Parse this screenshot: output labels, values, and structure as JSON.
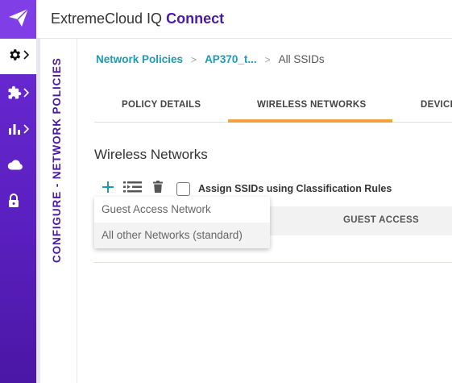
{
  "header": {
    "brand_main": "ExtremeCloud IQ",
    "brand_strong": "Connect"
  },
  "rail": {
    "items": [
      "settings-icon",
      "puzzle-icon",
      "bar-chart-icon",
      "cloud-icon",
      "lock-icon"
    ],
    "accent": "#6b2bd6"
  },
  "section": {
    "vertical_title": "CONFIGURE - NETWORK POLICIES"
  },
  "breadcrumb": {
    "items": [
      "Network Policies",
      "AP370_t...",
      "All SSIDs"
    ]
  },
  "tabs": {
    "items": [
      "POLICY DETAILS",
      "WIRELESS NETWORKS",
      "DEVICE"
    ],
    "active": "WIRELESS NETWORKS",
    "active_color": "#f3a13c"
  },
  "main": {
    "title": "Wireless Networks",
    "assign_label": "Assign SSIDs using Classification Rules",
    "table_headers": [
      "GUEST ACCESS"
    ]
  },
  "menu": {
    "items": [
      "Guest Access Network",
      "All other Networks (standard)"
    ]
  }
}
